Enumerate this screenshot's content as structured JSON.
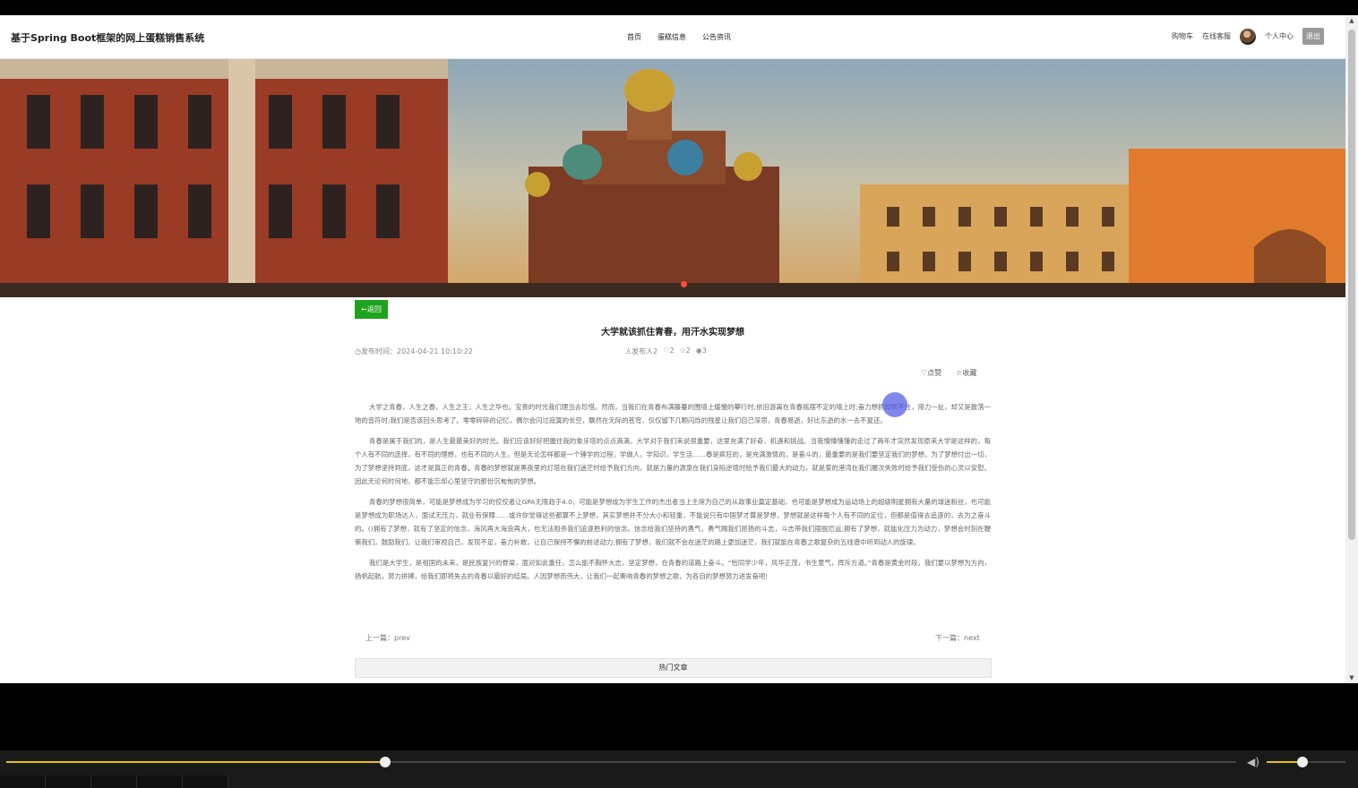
{
  "header": {
    "site_title": "基于Spring Boot框架的网上蛋糕销售系统",
    "nav": [
      "首页",
      "蛋糕信息",
      "公告资讯"
    ],
    "cart": "购物车",
    "service": "在线客服",
    "profile": "个人中心",
    "logout": "退出"
  },
  "article": {
    "back": "←返回",
    "title": "大学就该抓住青春，用汗水实现梦想",
    "publish_time": "◷发布时间：2024-04-21 10:10:22",
    "author": "♙发布人2",
    "likes": "♡2",
    "favorites": "☆2",
    "views": "◉3",
    "like_btn": "♡点赞",
    "fav_btn": "☆收藏",
    "paragraphs": [
      "大学之青春，人生之春，人生之王，人生之华也。宝贵的时光我们理当去珍惜。然而，当我们在青春布满藤蔓的围墙上缓慢的攀行时;依旧游离在青春摇摆不定的墙上时;奋力想抓却抓不住，用力一扯，却又是散落一地的音符时;我们是否该回头思考了。零零碎碎的记忆，偶尔会闪过寂寞的长空，飘然在无际的苍穹，仅仅留下几颗闪烁的残星让我们自己深思，青春易逝，好比东逝的水一去不复还。",
      "青春是属于我们的，是人生最最美好的时光。我们应该好好把握住我的象牙塔的点点滴滴。大学对于我们来说很重要，这里充满了好奇、机遇和挑战。当我懵懵懂懂的走过了两年才突然发现原来大学是这样的，每个人有不同的选择，有不同的理想，也有不同的人生。但是无论怎样都是一个锤学的过程，学做人，学知识，学生活……春是疯狂的，是充满激情的，是奋斗的，最重要的是我们要坚定我们的梦想，为了梦想付出一切，为了梦想坚持到底，这才是真正的青春。青春的梦想就是黑夜里的灯塔在我们迷茫时给予我们方向，就是力量的源泉在我们身陷逆境时给予我们最大的动力，就是爱的港湾在我们屡次失败时给予我们受伤的心灵以安慰。因此无论何时何地，都不能忘却心里坚守的那份沉甸甸的梦想。",
      "青春的梦想很简单，可能是梦想成为学习的佼佼者让GPA无限趋于4.0，可能是梦想成为学生工作的杰出者当上主席为自己的从政事业奠定基础，也可能是梦想成为运动场上的超级明星拥有大量的球迷粉丝，也可能是梦想成为职场达人，面试无压力，就业有保障……或许你觉得这些都算不上梦想，其实梦想并不分大小和轻重，不能说只有中国梦才算是梦想，梦想就是这样每个人有不同的定位，但都是值得去追逐的，去为之奋斗的。()拥有了梦想，就有了坚定的信念，海风再大海浪再大，也无法阻杀我们追逐胜利的信念。信念给我们坚持的勇气，勇气赐我们昂扬的斗志，斗志带我们摆脱厄运;拥有了梦想，就能化压力为动力，梦想会时刻在鞭策我们，鼓励我们，让我们审视自己，发现不足，奋力补救，让自己保持不懈的前进动力;拥有了梦想，我们就不会在迷茫的路上更加迷茫，我们就能在青春之歌复杂的五线谱中听到动人的旋律。",
      "我们是大学生，是祖国的未来，是民族复兴的脊梁，面对如此重任，怎么能不胸怀大志，坚定梦想，在青春的道路上奋斗。“恰同学少年，风华正茂，书生意气，挥斥方遒。”青春是黄金时段，我们要以梦想为方向，扬帆起航，努力拼搏，给我们即将失去的青春以最好的结局。人因梦想而伟大，让我们一起奏响青春的梦想之歌，为各自的梦想努力进发奋吧!"
    ],
    "prev": "上一篇：prev",
    "next": "下一篇：next",
    "hot": "热门文章"
  },
  "player": {
    "seek_progress": 0.308,
    "volume": 0.45,
    "accent": "#e8c400"
  },
  "icons": [
    "clock-icon",
    "user-icon",
    "thumb-up-icon",
    "star-icon",
    "eye-icon",
    "volume-icon"
  ]
}
